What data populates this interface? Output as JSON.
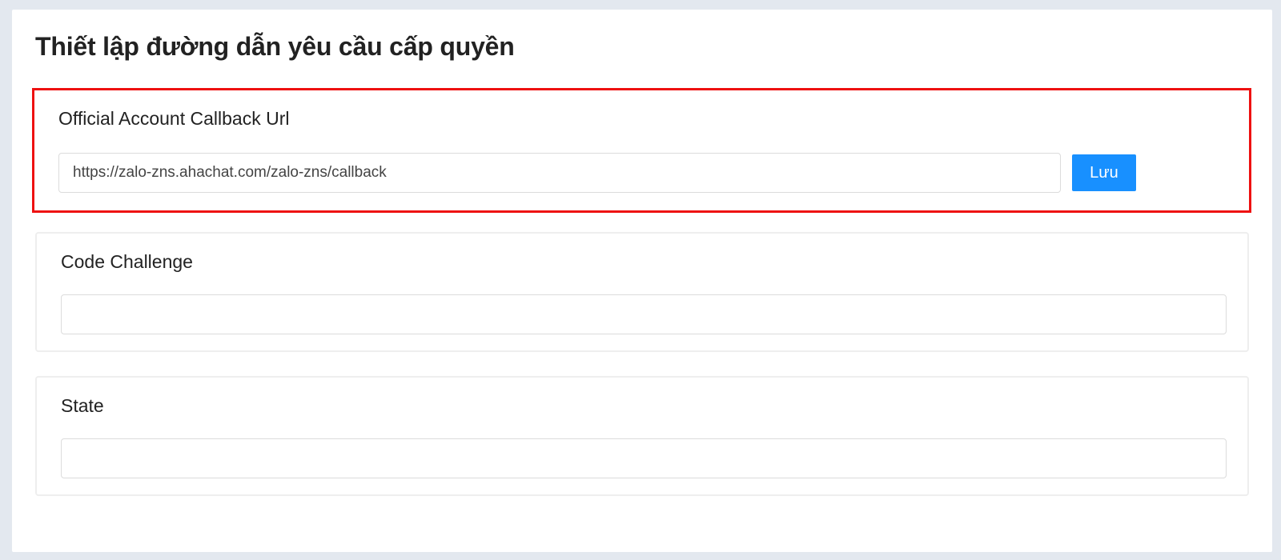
{
  "page": {
    "title": "Thiết lập đường dẫn yêu cầu cấp quyền"
  },
  "callback_section": {
    "label": "Official Account Callback Url",
    "input_value": "https://zalo-zns.ahachat.com/zalo-zns/callback",
    "save_label": "Lưu",
    "highlight_color": "#ee1111",
    "button_color": "#1890ff"
  },
  "code_challenge_section": {
    "label": "Code Challenge",
    "input_value": ""
  },
  "state_section": {
    "label": "State",
    "input_value": ""
  }
}
